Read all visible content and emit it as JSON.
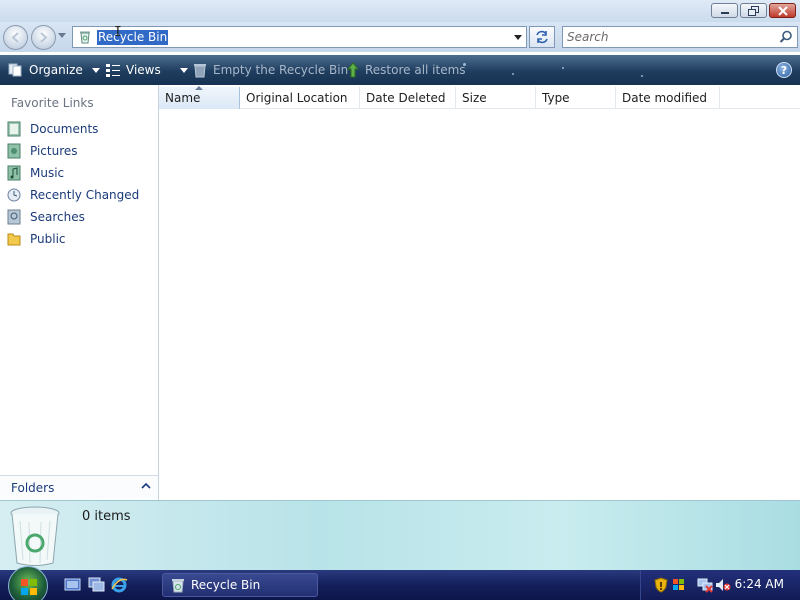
{
  "window": {
    "buttons": [
      "minimize",
      "maximize",
      "close"
    ]
  },
  "address": {
    "path": "Recycle Bin",
    "search_placeholder": "Search"
  },
  "toolbar": {
    "organize": "Organize",
    "views": "Views",
    "empty": "Empty the Recycle Bin",
    "restore": "Restore all items",
    "help": "?"
  },
  "nav": {
    "title": "Favorite Links",
    "items": [
      {
        "label": "Documents",
        "icon": "documents-icon"
      },
      {
        "label": "Pictures",
        "icon": "pictures-icon"
      },
      {
        "label": "Music",
        "icon": "music-icon"
      },
      {
        "label": "Recently Changed",
        "icon": "recently-changed-icon"
      },
      {
        "label": "Searches",
        "icon": "searches-icon"
      },
      {
        "label": "Public",
        "icon": "public-folder-icon"
      }
    ],
    "folders": "Folders"
  },
  "columns": [
    "Name",
    "Original Location",
    "Date Deleted",
    "Size",
    "Type",
    "Date modified"
  ],
  "details": {
    "count": "0 items"
  },
  "taskbar": {
    "task": "Recycle Bin",
    "time": "6:24 AM"
  },
  "colors": {
    "command_bar": "#1f3d5e",
    "selection": "#3169c6",
    "taskbar": "#141f5b",
    "details_pane": "#b8e3e8"
  }
}
